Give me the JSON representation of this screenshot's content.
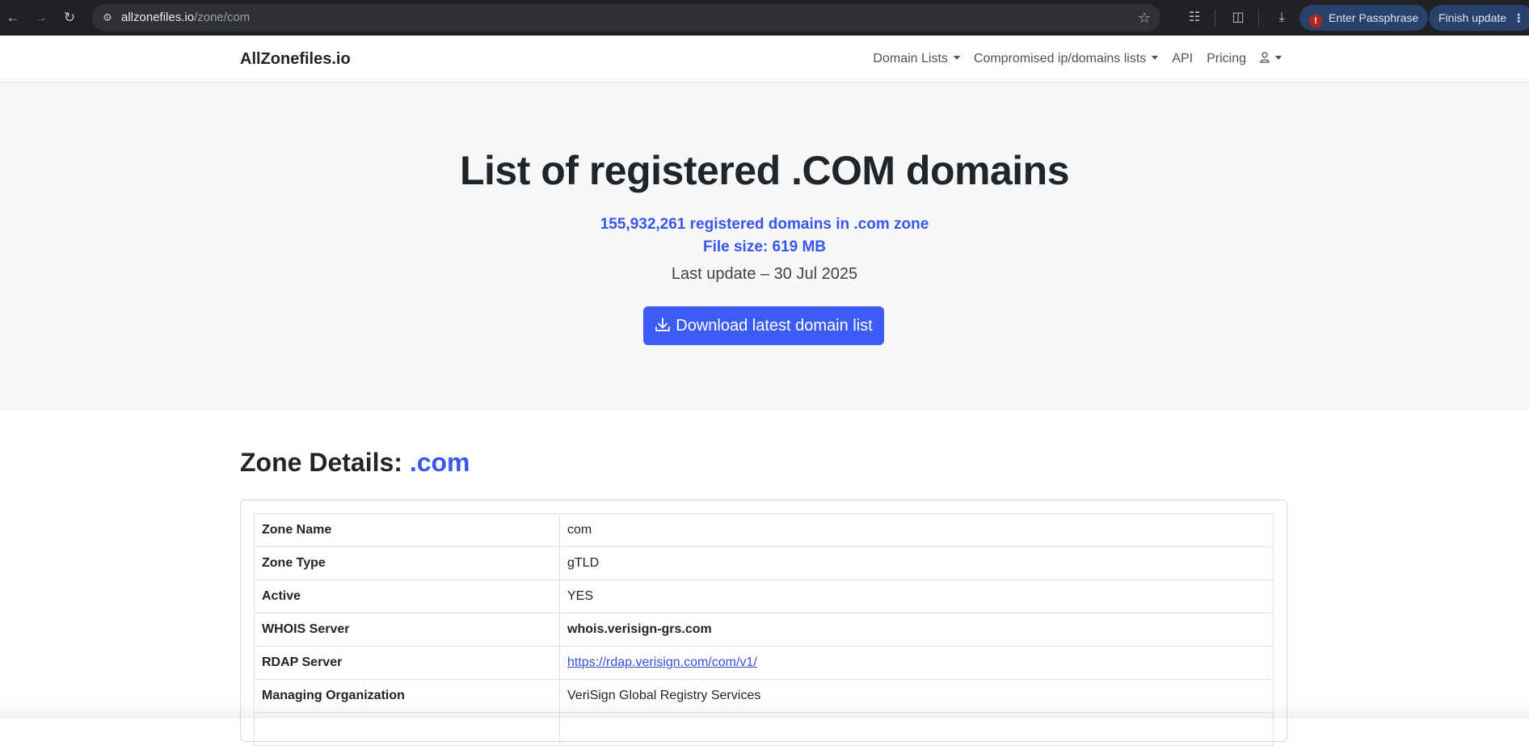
{
  "browser": {
    "url_host": "allzonefiles.io",
    "url_path": "/zone/com",
    "passphrase_label": "Enter Passphrase",
    "update_label": "Finish update"
  },
  "navbar": {
    "brand": "AllZonefiles.io",
    "items": [
      {
        "label": "Domain Lists",
        "dropdown": true
      },
      {
        "label": "Compromised ip/domains lists",
        "dropdown": true
      },
      {
        "label": "API",
        "dropdown": false
      },
      {
        "label": "Pricing",
        "dropdown": false
      }
    ],
    "user_icon": "user-icon"
  },
  "hero": {
    "title": "List of registered .COM domains",
    "domain_count": "155,932,261 registered domains in .com zone",
    "file_size": "File size: 619 MB",
    "last_update": "Last update – 30 Jul 2025",
    "download_label": "Download latest domain list",
    "accent_color": "#3856f0"
  },
  "zone": {
    "title_prefix": "Zone Details:",
    "title_tld": ".com",
    "rows": [
      {
        "key": "Zone Name",
        "value": "com"
      },
      {
        "key": "Zone Type",
        "value": "gTLD"
      },
      {
        "key": "Active",
        "value": "YES"
      },
      {
        "key": "WHOIS Server",
        "value": "whois.verisign-grs.com"
      },
      {
        "key": "RDAP Server",
        "value": "https://rdap.verisign.com/com/v1/"
      },
      {
        "key": "Managing Organization",
        "value": "VeriSign Global Registry Services"
      }
    ]
  }
}
